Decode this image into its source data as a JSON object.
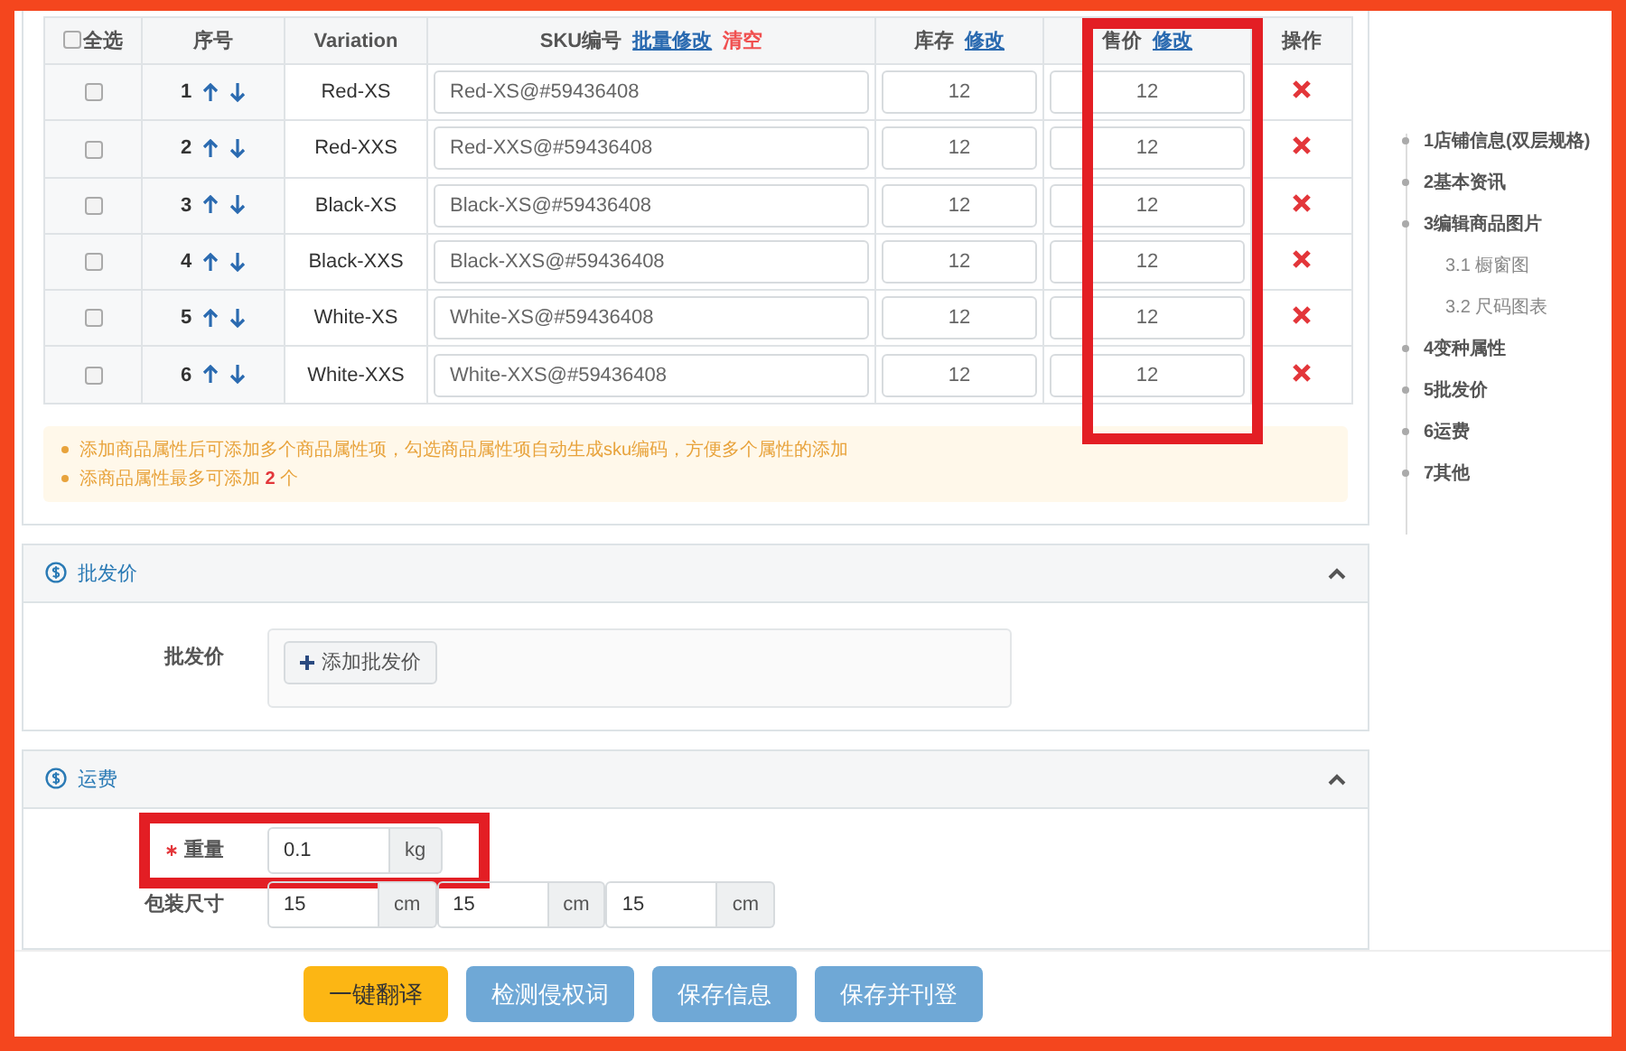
{
  "sku_table": {
    "select_all": {
      "label": "全选",
      "checked": false
    },
    "columns": [
      {
        "label": "序号"
      },
      {
        "label": "Variation"
      },
      {
        "label": "SKU编号",
        "links": [
          {
            "label": "批量修改",
            "kind": "edit"
          },
          {
            "label": "清空",
            "kind": "danger"
          }
        ]
      },
      {
        "label": "库存",
        "links": [
          {
            "label": "修改",
            "kind": "edit"
          }
        ]
      },
      {
        "label": "售价",
        "links": [
          {
            "label": "修改",
            "kind": "edit"
          }
        ],
        "highlighted": true
      },
      {
        "label": "操作"
      }
    ],
    "rows": [
      {
        "checked": false,
        "index": "1",
        "variation": "Red-XS",
        "sku": "Red-XS@#59436408",
        "stock": "12",
        "price": "12"
      },
      {
        "checked": false,
        "index": "2",
        "variation": "Red-XXS",
        "sku": "Red-XXS@#59436408",
        "stock": "12",
        "price": "12"
      },
      {
        "checked": false,
        "index": "3",
        "variation": "Black-XS",
        "sku": "Black-XS@#59436408",
        "stock": "12",
        "price": "12"
      },
      {
        "checked": false,
        "index": "4",
        "variation": "Black-XXS",
        "sku": "Black-XXS@#59436408",
        "stock": "12",
        "price": "12"
      },
      {
        "checked": false,
        "index": "5",
        "variation": "White-XS",
        "sku": "White-XS@#59436408",
        "stock": "12",
        "price": "12"
      },
      {
        "checked": false,
        "index": "6",
        "variation": "White-XXS",
        "sku": "White-XXS@#59436408",
        "stock": "12",
        "price": "12"
      }
    ],
    "tips": [
      "添加商品属性后可添加多个商品属性项，勾选商品属性项自动生成sku编码，方便多个属性的添加",
      "添商品属性最多可添加 **2** 个"
    ]
  },
  "wholesale": {
    "title": "批发价",
    "expanded": true,
    "label": "批发价",
    "button": "添加批发价"
  },
  "shipping": {
    "title": "运费",
    "expanded": true,
    "weight": {
      "label": "重量",
      "required": true,
      "value": "0.1",
      "unit": "kg",
      "highlighted": true
    },
    "size": {
      "label": "包装尺寸",
      "fields": [
        {
          "value": "15",
          "unit": "cm"
        },
        {
          "value": "15",
          "unit": "cm"
        },
        {
          "value": "15",
          "unit": "cm"
        }
      ]
    }
  },
  "nav": [
    {
      "label": "1店铺信息(双层规格)"
    },
    {
      "label": "2基本资讯"
    },
    {
      "label": "3编辑商品图片",
      "children": [
        {
          "label": "3.1 橱窗图"
        },
        {
          "label": "3.2 尺码图表"
        }
      ]
    },
    {
      "label": "4变种属性"
    },
    {
      "label": "5批发价"
    },
    {
      "label": "6运费"
    },
    {
      "label": "7其他"
    }
  ],
  "actions": [
    {
      "label": "一键翻译",
      "kind": "primary"
    },
    {
      "label": "检测侵权词",
      "kind": "secondary"
    },
    {
      "label": "保存信息",
      "kind": "secondary"
    },
    {
      "label": "保存并刊登",
      "kind": "secondary"
    }
  ]
}
